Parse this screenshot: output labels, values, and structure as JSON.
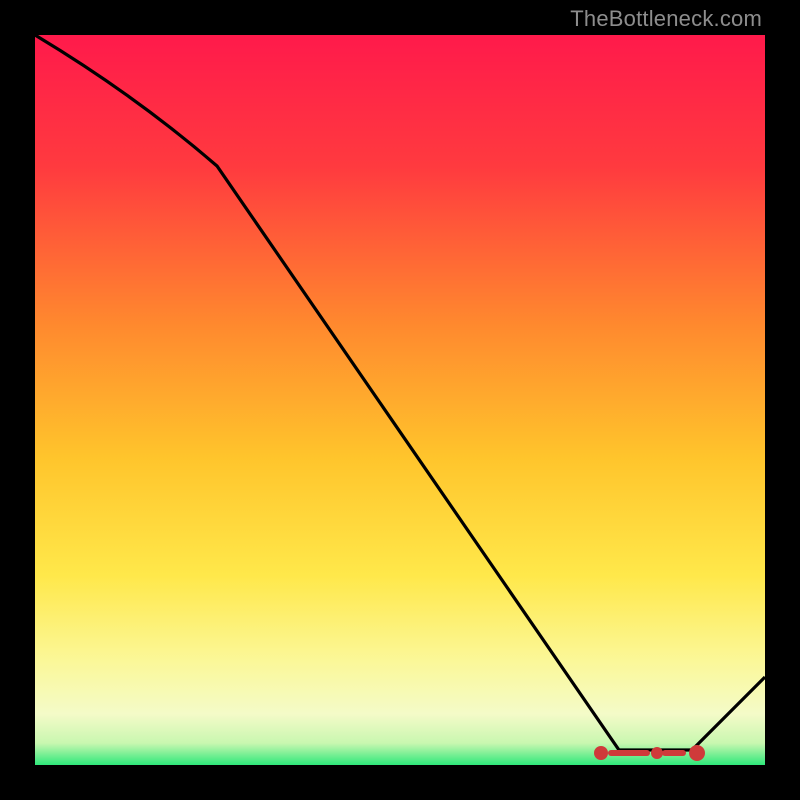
{
  "attribution": "TheBottleneck.com",
  "colors": {
    "bg": "#000000",
    "line": "#000000",
    "markers": "#d23a3a",
    "grad_top": "#ff1a4b",
    "grad_upper_mid": "#ff5a3a",
    "grad_mid": "#ffb52c",
    "grad_lower_mid": "#ffe84a",
    "grad_pale": "#fdfccc",
    "grad_bottom": "#2ee87a"
  },
  "chart_data": {
    "type": "line",
    "title": "",
    "xlabel": "",
    "ylabel": "",
    "xlim": [
      0,
      100
    ],
    "ylim": [
      0,
      100
    ],
    "x": [
      0,
      25,
      80,
      90,
      100
    ],
    "values": [
      100,
      82,
      2,
      2,
      12
    ],
    "optimal_zone": {
      "x_start": 78,
      "x_end": 90,
      "y": 2
    },
    "annotations": []
  }
}
